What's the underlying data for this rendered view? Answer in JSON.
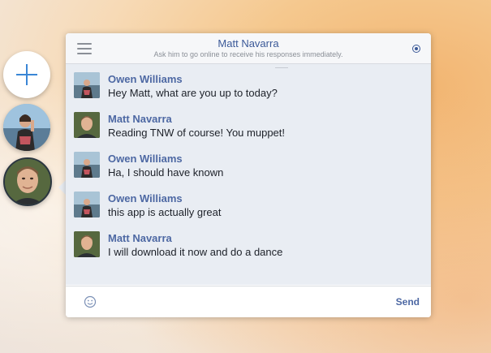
{
  "rail": {
    "new_chat_icon": "plus-icon",
    "heads": [
      {
        "id": "owen-williams"
      },
      {
        "id": "matt-navarra",
        "active": true
      }
    ]
  },
  "header": {
    "title": "Matt Navarra",
    "subtitle": "Ask him to go online to receive his responses immediately.",
    "menu_icon": "hamburger-menu-icon",
    "status_icon": "radio-status-icon"
  },
  "messages": [
    {
      "sender": "Owen Williams",
      "avatar": "owen",
      "text": "Hey Matt, what are you up to today?"
    },
    {
      "sender": "Matt Navarra",
      "avatar": "matt",
      "text": "Reading TNW of course! You muppet!"
    },
    {
      "sender": "Owen Williams",
      "avatar": "owen",
      "text": "Ha, I should have known"
    },
    {
      "sender": "Owen Williams",
      "avatar": "owen",
      "text": "this app is actually great"
    },
    {
      "sender": "Matt Navarra",
      "avatar": "matt",
      "text": "I will download it now and do a dance"
    }
  ],
  "composer": {
    "emoji_icon": "smiley-icon",
    "send_label": "Send"
  },
  "colors": {
    "accent": "#3b5998",
    "sender": "#4d68a3",
    "thread_bg": "#e9edf3"
  }
}
